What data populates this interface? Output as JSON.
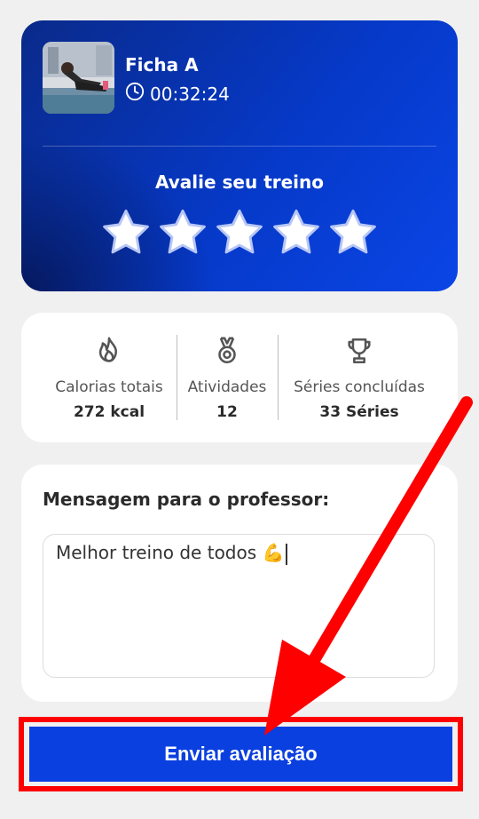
{
  "workout": {
    "thumbnail_icon": "stretching-photo",
    "name": "Ficha A",
    "duration": "00:32:24"
  },
  "rating": {
    "title": "Avalie seu treino",
    "max_stars": 5
  },
  "stats": [
    {
      "icon": "flame-icon",
      "label": "Calorias totais",
      "value": "272 kcal"
    },
    {
      "icon": "medal-icon",
      "label": "Atividades",
      "value": "12"
    },
    {
      "icon": "trophy-icon",
      "label": "Séries concluídas",
      "value": "33 Séries"
    }
  ],
  "message": {
    "label": "Mensagem para o professor:",
    "value": "Melhor treino de todos 💪"
  },
  "submit": {
    "label": "Enviar avaliação"
  },
  "colors": {
    "primary": "#0a3fe0",
    "annotation": "#ff0000"
  }
}
